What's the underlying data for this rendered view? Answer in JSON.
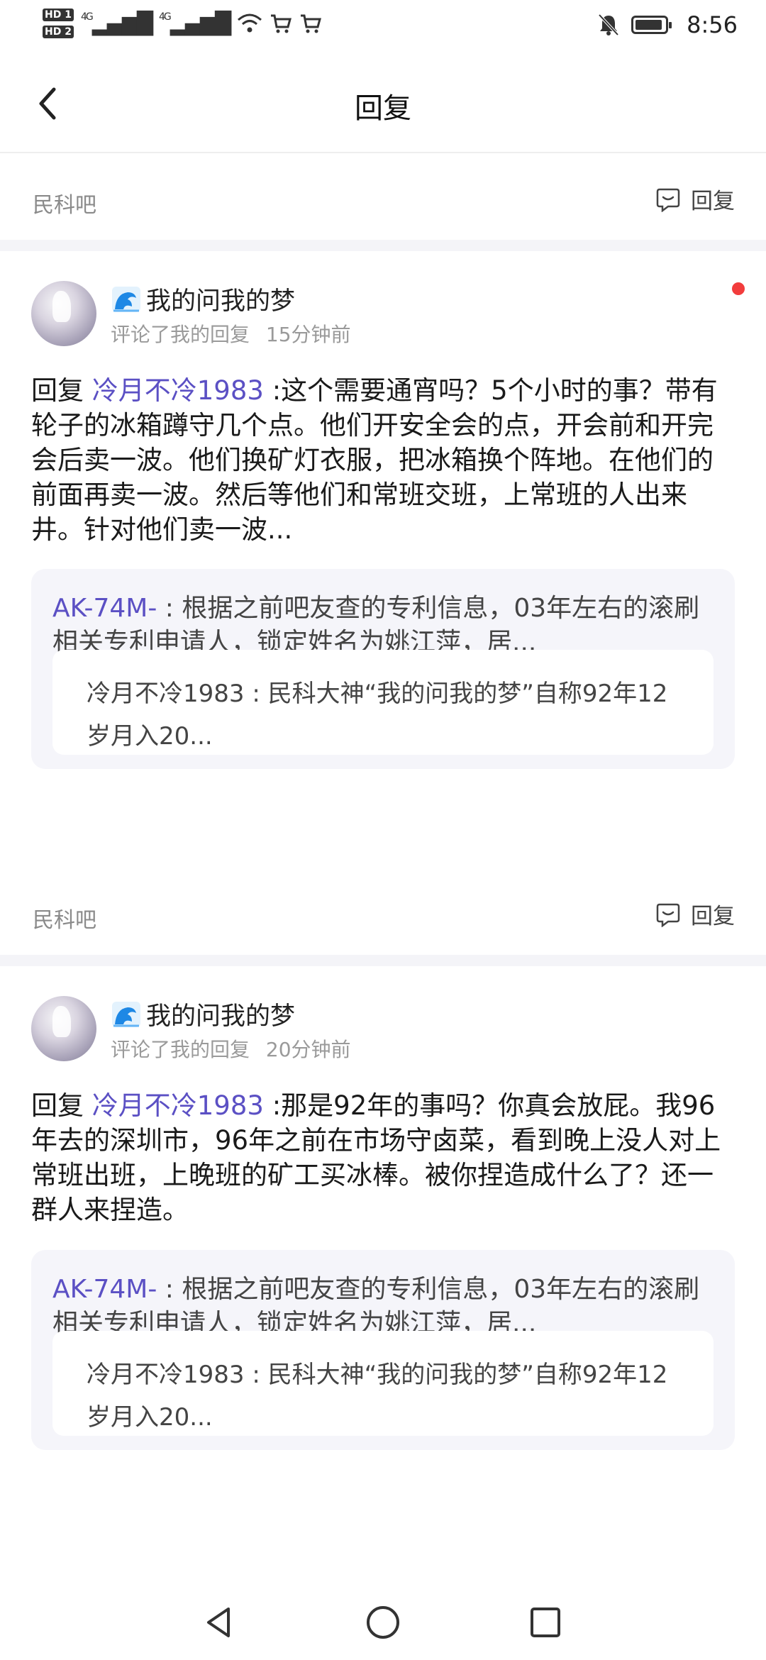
{
  "status_bar": {
    "sim1": "HD 1",
    "sim2": "HD 2",
    "signal1": "4G",
    "signal2": "4G",
    "time": "8:56",
    "icons": [
      "wifi-icon",
      "cart-icon",
      "cart-icon",
      "bell-off-icon",
      "battery-icon"
    ]
  },
  "header": {
    "title": "回复",
    "back_icon": "chevron-left-icon"
  },
  "forum_top": {
    "name": "民科吧",
    "reply_label": "回复"
  },
  "notifications": [
    {
      "user": "我的问我的梦",
      "meta_action": "评论了我的回复",
      "meta_time": "15分钟前",
      "unread": true,
      "reply_prefix": "回复 ",
      "mention": "冷月不冷1983",
      "text": " :这个需要通宵吗？5个小时的事？带有轮子的冰箱蹲守几个点。他们开安全会的点，开会前和开完会后卖一波。他们换矿灯衣服，把冰箱换个阵地。在他们的前面再卖一波。然后等他们和常班交班，上常班的人出来井。针对他们卖一波...",
      "quote_author": "AK-74M-",
      "quote_text": " : 根据之前吧友查的专利信息，03年左右的滚刷相关专利申请人，锁定姓名为姚江萍，居...",
      "inner_quote": "冷月不冷1983 : 民科大神“我的问我的梦”自称92年12岁月入20...",
      "forum_name": "民科吧",
      "reply_label": "回复"
    },
    {
      "user": "我的问我的梦",
      "meta_action": "评论了我的回复",
      "meta_time": "20分钟前",
      "unread": false,
      "reply_prefix": "回复 ",
      "mention": "冷月不冷1983",
      "text": " :那是92年的事吗？你真会放屁。我96年去的深圳市，96年之前在市场守卤菜，看到晚上没人对上常班出班，上晚班的矿工买冰棒。被你捏造成什么了？还一群人来捏造。",
      "quote_author": "AK-74M-",
      "quote_text": " : 根据之前吧友查的专利信息，03年左右的滚刷相关专利申请人，锁定姓名为姚江萍，居...",
      "inner_quote": "冷月不冷1983 : 民科大神“我的问我的梦”自称92年12岁月入20..."
    }
  ],
  "nav": {
    "back": "triangle-back-icon",
    "home": "circle-home-icon",
    "recents": "square-recents-icon"
  },
  "colors": {
    "accent": "#5b50c4",
    "unread_dot": "#f23c3c",
    "muted": "#9a9a9a",
    "quote_bg": "#f5f5fa"
  }
}
